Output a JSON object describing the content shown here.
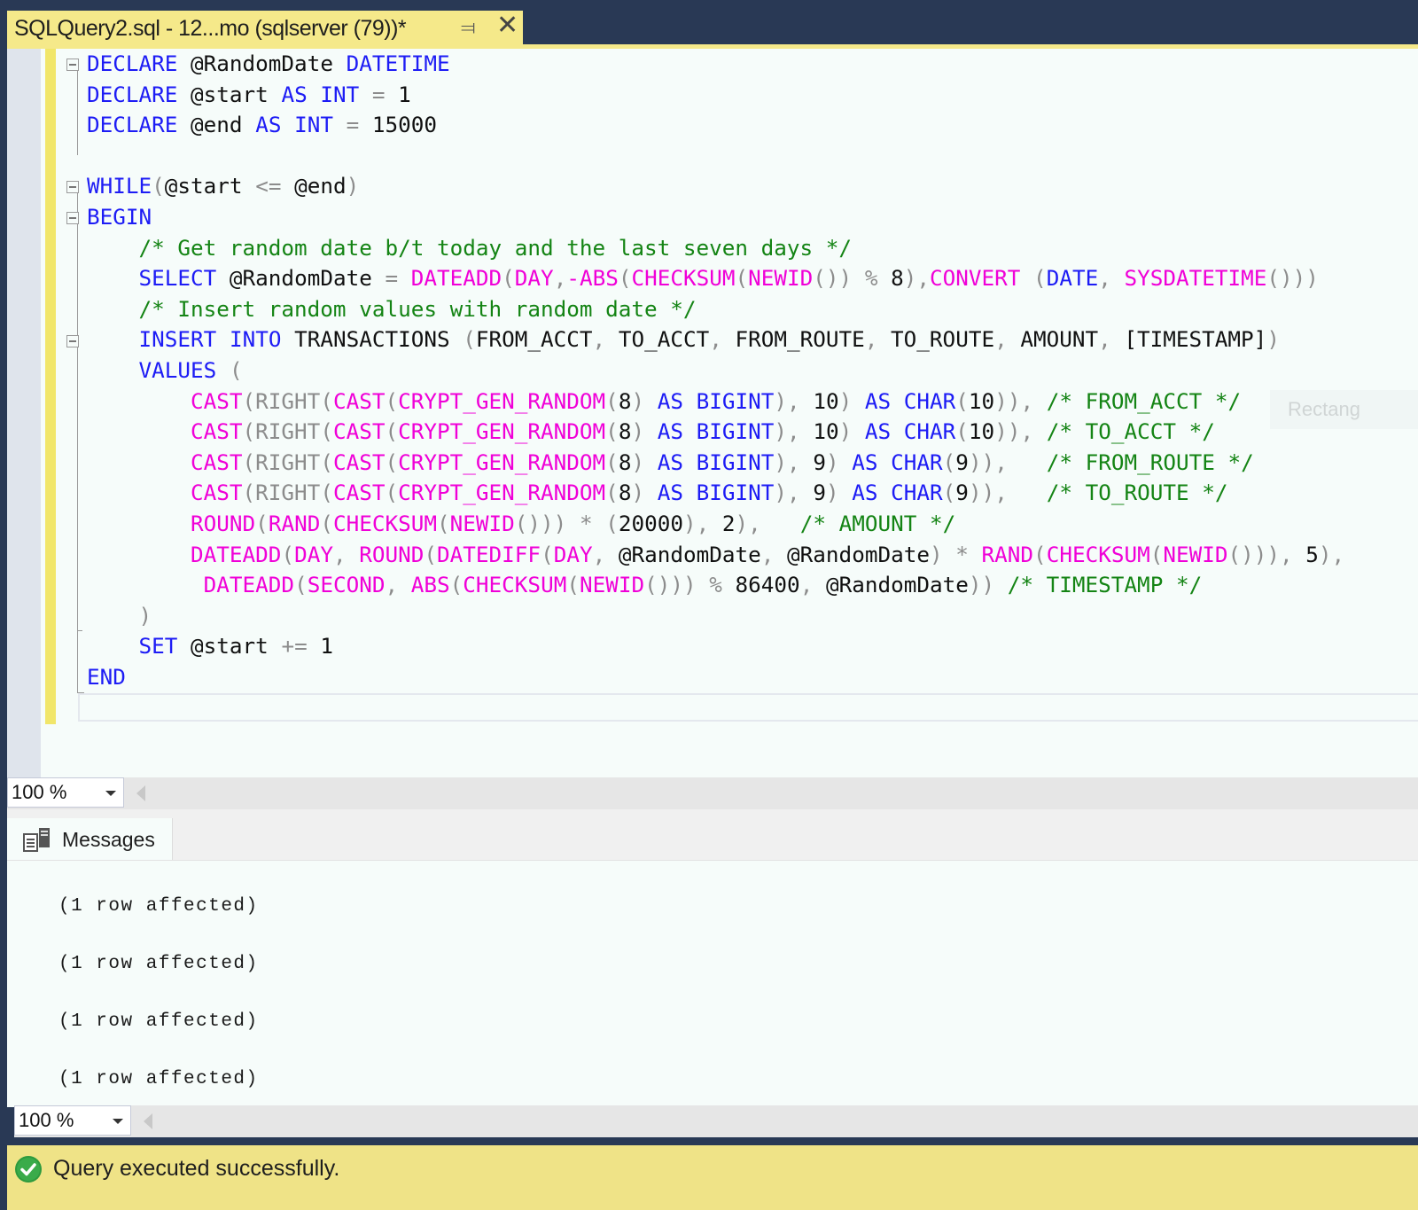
{
  "tab": {
    "title": "SQLQuery2.sql - 12...mo (sqlserver (79))*",
    "pin_icon": "pin-icon",
    "close_icon": "close-icon"
  },
  "editor": {
    "lines": [
      [
        {
          "c": "kw",
          "t": "DECLARE"
        },
        {
          "c": "tx",
          "t": " @RandomDate "
        },
        {
          "c": "kw",
          "t": "DATETIME"
        }
      ],
      [
        {
          "c": "kw",
          "t": "DECLARE"
        },
        {
          "c": "tx",
          "t": " @start "
        },
        {
          "c": "kw",
          "t": "AS"
        },
        {
          "c": "tx",
          "t": " "
        },
        {
          "c": "kw",
          "t": "INT"
        },
        {
          "c": "op",
          "t": " = "
        },
        {
          "c": "tx",
          "t": "1"
        }
      ],
      [
        {
          "c": "kw",
          "t": "DECLARE"
        },
        {
          "c": "tx",
          "t": " @end "
        },
        {
          "c": "kw",
          "t": "AS"
        },
        {
          "c": "tx",
          "t": " "
        },
        {
          "c": "kw",
          "t": "INT"
        },
        {
          "c": "op",
          "t": " = "
        },
        {
          "c": "tx",
          "t": "15000"
        }
      ],
      [],
      [
        {
          "c": "kw",
          "t": "WHILE"
        },
        {
          "c": "op",
          "t": "("
        },
        {
          "c": "tx",
          "t": "@start "
        },
        {
          "c": "op",
          "t": "<="
        },
        {
          "c": "tx",
          "t": " @end"
        },
        {
          "c": "op",
          "t": ")"
        }
      ],
      [
        {
          "c": "kw",
          "t": "BEGIN"
        }
      ],
      [
        {
          "c": "tx",
          "t": "    "
        },
        {
          "c": "cm",
          "t": "/* Get random date b/t today and the last seven days */"
        }
      ],
      [
        {
          "c": "tx",
          "t": "    "
        },
        {
          "c": "kw",
          "t": "SELECT"
        },
        {
          "c": "tx",
          "t": " @RandomDate "
        },
        {
          "c": "op",
          "t": "="
        },
        {
          "c": "tx",
          "t": " "
        },
        {
          "c": "fn",
          "t": "DATEADD"
        },
        {
          "c": "op",
          "t": "("
        },
        {
          "c": "fn",
          "t": "DAY"
        },
        {
          "c": "op",
          "t": ","
        },
        {
          "c": "fn",
          "t": "-ABS"
        },
        {
          "c": "op",
          "t": "("
        },
        {
          "c": "fn",
          "t": "CHECKSUM"
        },
        {
          "c": "op",
          "t": "("
        },
        {
          "c": "fn",
          "t": "NEWID"
        },
        {
          "c": "op",
          "t": "())"
        },
        {
          "c": "tx",
          "t": " "
        },
        {
          "c": "op",
          "t": "%"
        },
        {
          "c": "tx",
          "t": " 8"
        },
        {
          "c": "op",
          "t": "),"
        },
        {
          "c": "fn",
          "t": "CONVERT"
        },
        {
          "c": "tx",
          "t": " "
        },
        {
          "c": "op",
          "t": "("
        },
        {
          "c": "kw",
          "t": "DATE"
        },
        {
          "c": "op",
          "t": ","
        },
        {
          "c": "tx",
          "t": " "
        },
        {
          "c": "fn",
          "t": "SYSDATETIME"
        },
        {
          "c": "op",
          "t": "()))"
        }
      ],
      [
        {
          "c": "tx",
          "t": "    "
        },
        {
          "c": "cm",
          "t": "/* Insert random values with random date */"
        }
      ],
      [
        {
          "c": "tx",
          "t": "    "
        },
        {
          "c": "kw",
          "t": "INSERT"
        },
        {
          "c": "tx",
          "t": " "
        },
        {
          "c": "kw",
          "t": "INTO"
        },
        {
          "c": "tx",
          "t": " TRANSACTIONS "
        },
        {
          "c": "op",
          "t": "("
        },
        {
          "c": "tx",
          "t": "FROM_ACCT"
        },
        {
          "c": "op",
          "t": ","
        },
        {
          "c": "tx",
          "t": " TO_ACCT"
        },
        {
          "c": "op",
          "t": ","
        },
        {
          "c": "tx",
          "t": " FROM_ROUTE"
        },
        {
          "c": "op",
          "t": ","
        },
        {
          "c": "tx",
          "t": " TO_ROUTE"
        },
        {
          "c": "op",
          "t": ","
        },
        {
          "c": "tx",
          "t": " AMOUNT"
        },
        {
          "c": "op",
          "t": ","
        },
        {
          "c": "tx",
          "t": " [TIMESTAMP]"
        },
        {
          "c": "op",
          "t": ")"
        }
      ],
      [
        {
          "c": "tx",
          "t": "    "
        },
        {
          "c": "kw",
          "t": "VALUES"
        },
        {
          "c": "tx",
          "t": " "
        },
        {
          "c": "op",
          "t": "("
        }
      ],
      [
        {
          "c": "tx",
          "t": "        "
        },
        {
          "c": "fn",
          "t": "CAST"
        },
        {
          "c": "op",
          "t": "(RIGHT("
        },
        {
          "c": "fn",
          "t": "CAST"
        },
        {
          "c": "op",
          "t": "("
        },
        {
          "c": "fn",
          "t": "CRYPT_GEN_RANDOM"
        },
        {
          "c": "op",
          "t": "("
        },
        {
          "c": "tx",
          "t": "8"
        },
        {
          "c": "op",
          "t": ")"
        },
        {
          "c": "tx",
          "t": " "
        },
        {
          "c": "kw",
          "t": "AS"
        },
        {
          "c": "tx",
          "t": " "
        },
        {
          "c": "kw",
          "t": "BIGINT"
        },
        {
          "c": "op",
          "t": "),"
        },
        {
          "c": "tx",
          "t": " 10"
        },
        {
          "c": "op",
          "t": ")"
        },
        {
          "c": "tx",
          "t": " "
        },
        {
          "c": "kw",
          "t": "AS"
        },
        {
          "c": "tx",
          "t": " "
        },
        {
          "c": "kw",
          "t": "CHAR"
        },
        {
          "c": "op",
          "t": "("
        },
        {
          "c": "tx",
          "t": "10"
        },
        {
          "c": "op",
          "t": ")),"
        },
        {
          "c": "tx",
          "t": " "
        },
        {
          "c": "cm",
          "t": "/* FROM_ACCT */"
        }
      ],
      [
        {
          "c": "tx",
          "t": "        "
        },
        {
          "c": "fn",
          "t": "CAST"
        },
        {
          "c": "op",
          "t": "(RIGHT("
        },
        {
          "c": "fn",
          "t": "CAST"
        },
        {
          "c": "op",
          "t": "("
        },
        {
          "c": "fn",
          "t": "CRYPT_GEN_RANDOM"
        },
        {
          "c": "op",
          "t": "("
        },
        {
          "c": "tx",
          "t": "8"
        },
        {
          "c": "op",
          "t": ")"
        },
        {
          "c": "tx",
          "t": " "
        },
        {
          "c": "kw",
          "t": "AS"
        },
        {
          "c": "tx",
          "t": " "
        },
        {
          "c": "kw",
          "t": "BIGINT"
        },
        {
          "c": "op",
          "t": "),"
        },
        {
          "c": "tx",
          "t": " 10"
        },
        {
          "c": "op",
          "t": ")"
        },
        {
          "c": "tx",
          "t": " "
        },
        {
          "c": "kw",
          "t": "AS"
        },
        {
          "c": "tx",
          "t": " "
        },
        {
          "c": "kw",
          "t": "CHAR"
        },
        {
          "c": "op",
          "t": "("
        },
        {
          "c": "tx",
          "t": "10"
        },
        {
          "c": "op",
          "t": ")),"
        },
        {
          "c": "tx",
          "t": " "
        },
        {
          "c": "cm",
          "t": "/* TO_ACCT */"
        }
      ],
      [
        {
          "c": "tx",
          "t": "        "
        },
        {
          "c": "fn",
          "t": "CAST"
        },
        {
          "c": "op",
          "t": "(RIGHT("
        },
        {
          "c": "fn",
          "t": "CAST"
        },
        {
          "c": "op",
          "t": "("
        },
        {
          "c": "fn",
          "t": "CRYPT_GEN_RANDOM"
        },
        {
          "c": "op",
          "t": "("
        },
        {
          "c": "tx",
          "t": "8"
        },
        {
          "c": "op",
          "t": ")"
        },
        {
          "c": "tx",
          "t": " "
        },
        {
          "c": "kw",
          "t": "AS"
        },
        {
          "c": "tx",
          "t": " "
        },
        {
          "c": "kw",
          "t": "BIGINT"
        },
        {
          "c": "op",
          "t": "),"
        },
        {
          "c": "tx",
          "t": " 9"
        },
        {
          "c": "op",
          "t": ")"
        },
        {
          "c": "tx",
          "t": " "
        },
        {
          "c": "kw",
          "t": "AS"
        },
        {
          "c": "tx",
          "t": " "
        },
        {
          "c": "kw",
          "t": "CHAR"
        },
        {
          "c": "op",
          "t": "("
        },
        {
          "c": "tx",
          "t": "9"
        },
        {
          "c": "op",
          "t": ")),"
        },
        {
          "c": "tx",
          "t": "   "
        },
        {
          "c": "cm",
          "t": "/* FROM_ROUTE */"
        }
      ],
      [
        {
          "c": "tx",
          "t": "        "
        },
        {
          "c": "fn",
          "t": "CAST"
        },
        {
          "c": "op",
          "t": "(RIGHT("
        },
        {
          "c": "fn",
          "t": "CAST"
        },
        {
          "c": "op",
          "t": "("
        },
        {
          "c": "fn",
          "t": "CRYPT_GEN_RANDOM"
        },
        {
          "c": "op",
          "t": "("
        },
        {
          "c": "tx",
          "t": "8"
        },
        {
          "c": "op",
          "t": ")"
        },
        {
          "c": "tx",
          "t": " "
        },
        {
          "c": "kw",
          "t": "AS"
        },
        {
          "c": "tx",
          "t": " "
        },
        {
          "c": "kw",
          "t": "BIGINT"
        },
        {
          "c": "op",
          "t": "),"
        },
        {
          "c": "tx",
          "t": " 9"
        },
        {
          "c": "op",
          "t": ")"
        },
        {
          "c": "tx",
          "t": " "
        },
        {
          "c": "kw",
          "t": "AS"
        },
        {
          "c": "tx",
          "t": " "
        },
        {
          "c": "kw",
          "t": "CHAR"
        },
        {
          "c": "op",
          "t": "("
        },
        {
          "c": "tx",
          "t": "9"
        },
        {
          "c": "op",
          "t": ")),"
        },
        {
          "c": "tx",
          "t": "   "
        },
        {
          "c": "cm",
          "t": "/* TO_ROUTE */"
        }
      ],
      [
        {
          "c": "tx",
          "t": "        "
        },
        {
          "c": "fn",
          "t": "ROUND"
        },
        {
          "c": "op",
          "t": "("
        },
        {
          "c": "fn",
          "t": "RAND"
        },
        {
          "c": "op",
          "t": "("
        },
        {
          "c": "fn",
          "t": "CHECKSUM"
        },
        {
          "c": "op",
          "t": "("
        },
        {
          "c": "fn",
          "t": "NEWID"
        },
        {
          "c": "op",
          "t": "()))"
        },
        {
          "c": "tx",
          "t": " "
        },
        {
          "c": "op",
          "t": "*"
        },
        {
          "c": "tx",
          "t": " "
        },
        {
          "c": "op",
          "t": "("
        },
        {
          "c": "tx",
          "t": "20000"
        },
        {
          "c": "op",
          "t": "),"
        },
        {
          "c": "tx",
          "t": " 2"
        },
        {
          "c": "op",
          "t": "),"
        },
        {
          "c": "tx",
          "t": "   "
        },
        {
          "c": "cm",
          "t": "/* AMOUNT */"
        }
      ],
      [
        {
          "c": "tx",
          "t": "        "
        },
        {
          "c": "fn",
          "t": "DATEADD"
        },
        {
          "c": "op",
          "t": "("
        },
        {
          "c": "fn",
          "t": "DAY"
        },
        {
          "c": "op",
          "t": ","
        },
        {
          "c": "tx",
          "t": " "
        },
        {
          "c": "fn",
          "t": "ROUND"
        },
        {
          "c": "op",
          "t": "("
        },
        {
          "c": "fn",
          "t": "DATEDIFF"
        },
        {
          "c": "op",
          "t": "("
        },
        {
          "c": "fn",
          "t": "DAY"
        },
        {
          "c": "op",
          "t": ","
        },
        {
          "c": "tx",
          "t": " @RandomDate"
        },
        {
          "c": "op",
          "t": ","
        },
        {
          "c": "tx",
          "t": " @RandomDate"
        },
        {
          "c": "op",
          "t": ")"
        },
        {
          "c": "tx",
          "t": " "
        },
        {
          "c": "op",
          "t": "*"
        },
        {
          "c": "tx",
          "t": " "
        },
        {
          "c": "fn",
          "t": "RAND"
        },
        {
          "c": "op",
          "t": "("
        },
        {
          "c": "fn",
          "t": "CHECKSUM"
        },
        {
          "c": "op",
          "t": "("
        },
        {
          "c": "fn",
          "t": "NEWID"
        },
        {
          "c": "op",
          "t": "())),"
        },
        {
          "c": "tx",
          "t": " 5"
        },
        {
          "c": "op",
          "t": "),"
        }
      ],
      [
        {
          "c": "tx",
          "t": "         "
        },
        {
          "c": "fn",
          "t": "DATEADD"
        },
        {
          "c": "op",
          "t": "("
        },
        {
          "c": "fn",
          "t": "SECOND"
        },
        {
          "c": "op",
          "t": ","
        },
        {
          "c": "tx",
          "t": " "
        },
        {
          "c": "fn",
          "t": "ABS"
        },
        {
          "c": "op",
          "t": "("
        },
        {
          "c": "fn",
          "t": "CHECKSUM"
        },
        {
          "c": "op",
          "t": "("
        },
        {
          "c": "fn",
          "t": "NEWID"
        },
        {
          "c": "op",
          "t": "()))"
        },
        {
          "c": "tx",
          "t": " "
        },
        {
          "c": "op",
          "t": "%"
        },
        {
          "c": "tx",
          "t": " 86400"
        },
        {
          "c": "op",
          "t": ","
        },
        {
          "c": "tx",
          "t": " @RandomDate"
        },
        {
          "c": "op",
          "t": "))"
        },
        {
          "c": "tx",
          "t": " "
        },
        {
          "c": "cm",
          "t": "/* TIMESTAMP */"
        }
      ],
      [
        {
          "c": "tx",
          "t": "    "
        },
        {
          "c": "op",
          "t": ")"
        }
      ],
      [
        {
          "c": "tx",
          "t": "    "
        },
        {
          "c": "kw",
          "t": "SET"
        },
        {
          "c": "tx",
          "t": " @start "
        },
        {
          "c": "op",
          "t": "+="
        },
        {
          "c": "tx",
          "t": " 1"
        }
      ],
      [
        {
          "c": "kw",
          "t": "END"
        }
      ]
    ],
    "ghost_tooltip": "Rectang"
  },
  "zoom_top": {
    "value": "100 %"
  },
  "results": {
    "tab_label": "Messages",
    "messages": [
      "(1 row affected)",
      "(1 row affected)",
      "(1 row affected)",
      "(1 row affected)"
    ]
  },
  "zoom_bottom": {
    "value": "100 %"
  },
  "status": {
    "text": "Query executed successfully.",
    "icon": "success-check-icon",
    "color": "#efe387"
  },
  "colors": {
    "keyword": "#1d1cf5",
    "function": "#f000d8",
    "comment": "#148414",
    "operator": "#8c8c8c",
    "tab_active": "#f5e98a",
    "chrome": "#293955"
  }
}
